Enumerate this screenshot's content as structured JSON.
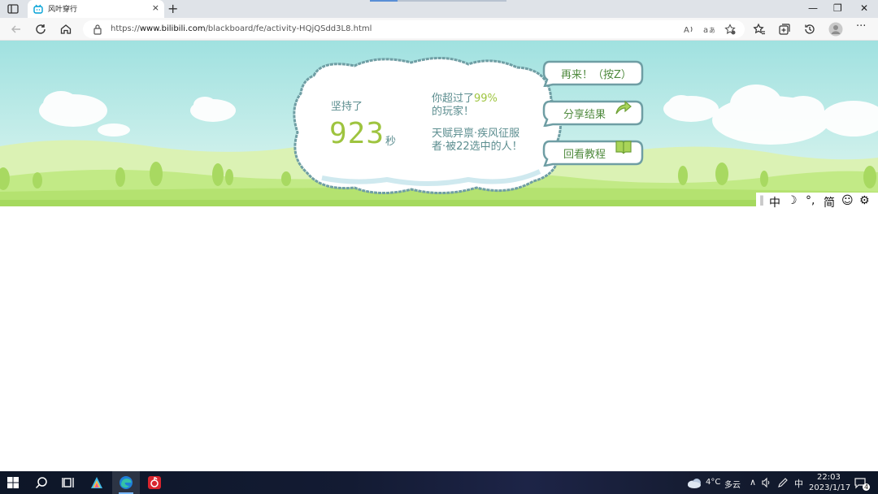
{
  "browser": {
    "tab_title": "风叶穿行",
    "tab_close": "×",
    "new_tab": "+",
    "url_prefix": "https://",
    "url_host": "www.bilibili.com",
    "url_path": "/blackboard/fe/activity-HQjQSdd3L8.html",
    "window_controls": {
      "minimize": "—",
      "restore": "❐",
      "close": "✕"
    },
    "icons": [
      "sidebar-toggle-icon",
      "back-icon",
      "refresh-icon",
      "home-icon",
      "lock-icon",
      "read-aloud-icon",
      "translate-icon",
      "add-favorite-icon",
      "favorites-icon",
      "collections-icon",
      "history-icon",
      "profile-icon",
      "more-icon"
    ],
    "more_label": "···"
  },
  "game": {
    "persist_label": "坚持了",
    "seconds_value": "923",
    "seconds_unit": "秒",
    "beat_prefix": "你超过了",
    "beat_percent": "99%",
    "beat_suffix": "的玩家！",
    "talent_line1": "天赋异禀·疾风征服",
    "talent_line2": "者·被22选中的人！",
    "buttons": {
      "retry": "再来！（按Z）",
      "share": "分享结果",
      "tutorial": "回看教程"
    },
    "toolbar": {
      "lang": "中",
      "night": "☽",
      "punct": "°,",
      "simplified": "简",
      "emoji": "☺",
      "settings": "⚙"
    },
    "colors": {
      "sky_top": "#9fe0e0",
      "grass": "#c6ec8e",
      "accent_green": "#9ec43f",
      "text_teal": "#5b8d8f"
    }
  },
  "taskbar": {
    "weather_temp": "4°C",
    "weather_desc": "多云",
    "ime": "中",
    "time": "22:03",
    "date": "2023/1/17",
    "notification_count": "4",
    "apps": [
      "start-icon",
      "search-icon",
      "task-view-icon",
      "app-icon",
      "edge-icon",
      "netease-music-icon"
    ]
  }
}
